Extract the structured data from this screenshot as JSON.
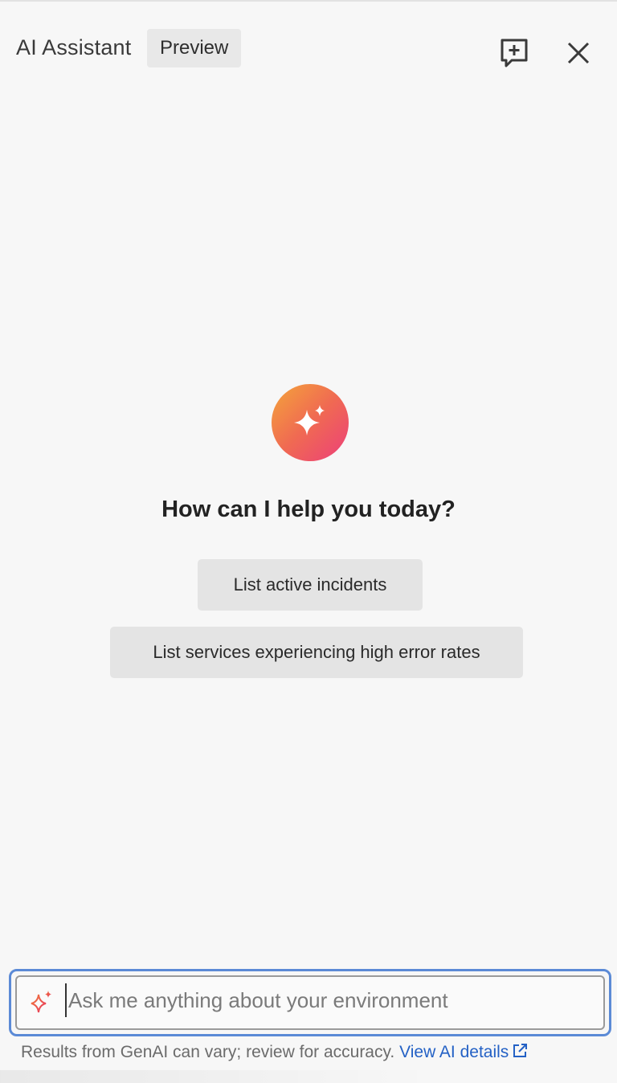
{
  "header": {
    "title": "AI Assistant",
    "badge": "Preview",
    "new_chat_icon": "chat-plus-icon",
    "close_icon": "close-icon"
  },
  "main": {
    "logo_icon": "sparkle-icon",
    "greeting": "How can I help you today?",
    "suggestions": [
      "List active incidents",
      "List services experiencing high error rates"
    ]
  },
  "input": {
    "placeholder": "Ask me anything about your environment",
    "value": "",
    "icon": "sparkle-icon"
  },
  "footer": {
    "disclaimer": "Results from GenAI can vary; review for accuracy.",
    "link_label": "View AI details",
    "link_icon": "external-link-icon"
  },
  "colors": {
    "accent": "#2461c5",
    "focus_ring": "#5b8ad6",
    "logo_gradient_start": "#f4a53a",
    "logo_gradient_end": "#ec3f7a"
  }
}
